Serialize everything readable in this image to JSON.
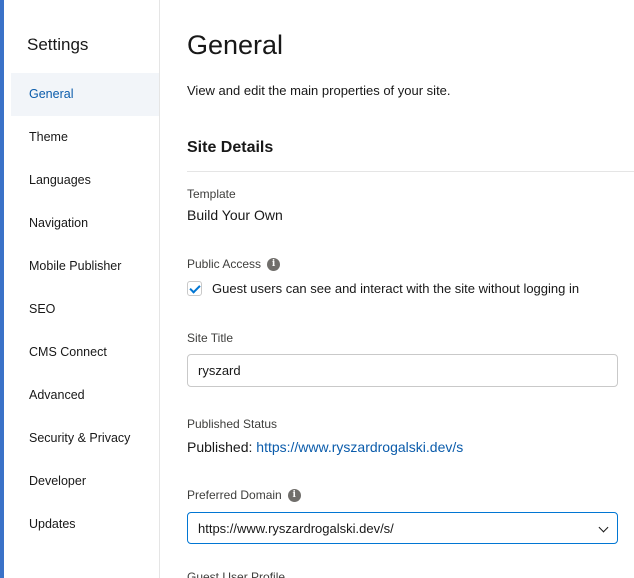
{
  "sidebar": {
    "title": "Settings",
    "items": [
      {
        "label": "General",
        "active": true
      },
      {
        "label": "Theme",
        "active": false
      },
      {
        "label": "Languages",
        "active": false
      },
      {
        "label": "Navigation",
        "active": false
      },
      {
        "label": "Mobile Publisher",
        "active": false
      },
      {
        "label": "SEO",
        "active": false
      },
      {
        "label": "CMS Connect",
        "active": false
      },
      {
        "label": "Advanced",
        "active": false
      },
      {
        "label": "Security & Privacy",
        "active": false
      },
      {
        "label": "Developer",
        "active": false
      },
      {
        "label": "Updates",
        "active": false
      }
    ]
  },
  "main": {
    "title": "General",
    "description": "View and edit the main properties of your site.",
    "section_title": "Site Details",
    "template": {
      "label": "Template",
      "value": "Build Your Own"
    },
    "public_access": {
      "label": "Public Access",
      "info_icon": "info-icon",
      "checkbox_label": "Guest users can see and interact with the site without logging in",
      "checked": true
    },
    "site_title": {
      "label": "Site Title",
      "value": "ryszard"
    },
    "published_status": {
      "label": "Published Status",
      "prefix": "Published:",
      "url": "https://www.ryszardrogalski.dev/s"
    },
    "preferred_domain": {
      "label": "Preferred Domain",
      "info_icon": "info-icon",
      "selected": "https://www.ryszardrogalski.dev/s/"
    },
    "next_field_label": "Guest User Profile"
  },
  "colors": {
    "accent": "#3a72c8",
    "link": "#0b5cab",
    "focus_border": "#0176d3",
    "active_nav_bg": "#f2f5f9"
  }
}
